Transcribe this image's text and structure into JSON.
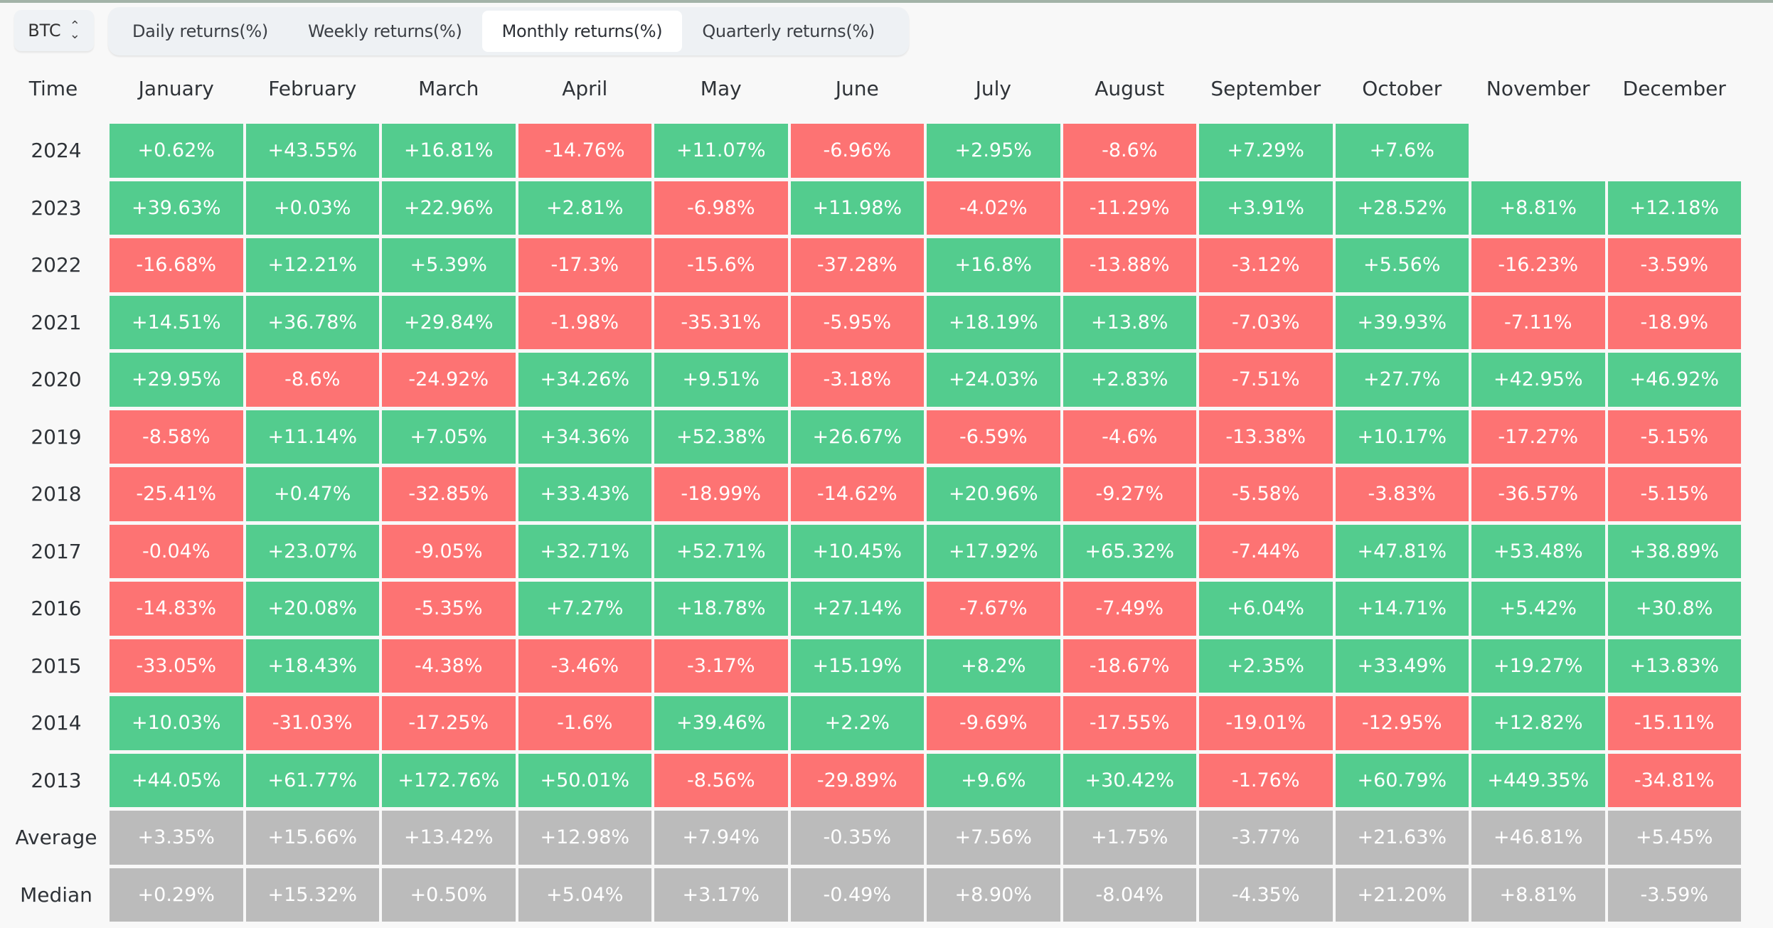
{
  "selector": {
    "value": "BTC",
    "icon": "up-down-chevron-icon"
  },
  "tabs": [
    {
      "label": "Daily returns(%)",
      "active": false
    },
    {
      "label": "Weekly returns(%)",
      "active": false
    },
    {
      "label": "Monthly returns(%)",
      "active": true
    },
    {
      "label": "Quarterly returns(%)",
      "active": false
    }
  ],
  "colors": {
    "positive": "#53cc8e",
    "negative": "#fd7373",
    "stat": "#bbbbbb"
  },
  "chart_data": {
    "type": "heatmap",
    "title": "BTC Monthly returns(%)",
    "row_header": "Time",
    "columns": [
      "January",
      "February",
      "March",
      "April",
      "May",
      "June",
      "July",
      "August",
      "September",
      "October",
      "November",
      "December"
    ],
    "rows": [
      {
        "label": "2024",
        "kind": "year",
        "values": [
          "+0.62%",
          "+43.55%",
          "+16.81%",
          "-14.76%",
          "+11.07%",
          "-6.96%",
          "+2.95%",
          "-8.6%",
          "+7.29%",
          "+7.6%",
          null,
          null
        ]
      },
      {
        "label": "2023",
        "kind": "year",
        "values": [
          "+39.63%",
          "+0.03%",
          "+22.96%",
          "+2.81%",
          "-6.98%",
          "+11.98%",
          "-4.02%",
          "-11.29%",
          "+3.91%",
          "+28.52%",
          "+8.81%",
          "+12.18%"
        ]
      },
      {
        "label": "2022",
        "kind": "year",
        "values": [
          "-16.68%",
          "+12.21%",
          "+5.39%",
          "-17.3%",
          "-15.6%",
          "-37.28%",
          "+16.8%",
          "-13.88%",
          "-3.12%",
          "+5.56%",
          "-16.23%",
          "-3.59%"
        ]
      },
      {
        "label": "2021",
        "kind": "year",
        "values": [
          "+14.51%",
          "+36.78%",
          "+29.84%",
          "-1.98%",
          "-35.31%",
          "-5.95%",
          "+18.19%",
          "+13.8%",
          "-7.03%",
          "+39.93%",
          "-7.11%",
          "-18.9%"
        ]
      },
      {
        "label": "2020",
        "kind": "year",
        "values": [
          "+29.95%",
          "-8.6%",
          "-24.92%",
          "+34.26%",
          "+9.51%",
          "-3.18%",
          "+24.03%",
          "+2.83%",
          "-7.51%",
          "+27.7%",
          "+42.95%",
          "+46.92%"
        ]
      },
      {
        "label": "2019",
        "kind": "year",
        "values": [
          "-8.58%",
          "+11.14%",
          "+7.05%",
          "+34.36%",
          "+52.38%",
          "+26.67%",
          "-6.59%",
          "-4.6%",
          "-13.38%",
          "+10.17%",
          "-17.27%",
          "-5.15%"
        ]
      },
      {
        "label": "2018",
        "kind": "year",
        "values": [
          "-25.41%",
          "+0.47%",
          "-32.85%",
          "+33.43%",
          "-18.99%",
          "-14.62%",
          "+20.96%",
          "-9.27%",
          "-5.58%",
          "-3.83%",
          "-36.57%",
          "-5.15%"
        ]
      },
      {
        "label": "2017",
        "kind": "year",
        "values": [
          "-0.04%",
          "+23.07%",
          "-9.05%",
          "+32.71%",
          "+52.71%",
          "+10.45%",
          "+17.92%",
          "+65.32%",
          "-7.44%",
          "+47.81%",
          "+53.48%",
          "+38.89%"
        ]
      },
      {
        "label": "2016",
        "kind": "year",
        "values": [
          "-14.83%",
          "+20.08%",
          "-5.35%",
          "+7.27%",
          "+18.78%",
          "+27.14%",
          "-7.67%",
          "-7.49%",
          "+6.04%",
          "+14.71%",
          "+5.42%",
          "+30.8%"
        ]
      },
      {
        "label": "2015",
        "kind": "year",
        "values": [
          "-33.05%",
          "+18.43%",
          "-4.38%",
          "-3.46%",
          "-3.17%",
          "+15.19%",
          "+8.2%",
          "-18.67%",
          "+2.35%",
          "+33.49%",
          "+19.27%",
          "+13.83%"
        ]
      },
      {
        "label": "2014",
        "kind": "year",
        "values": [
          "+10.03%",
          "-31.03%",
          "-17.25%",
          "-1.6%",
          "+39.46%",
          "+2.2%",
          "-9.69%",
          "-17.55%",
          "-19.01%",
          "-12.95%",
          "+12.82%",
          "-15.11%"
        ]
      },
      {
        "label": "2013",
        "kind": "year",
        "values": [
          "+44.05%",
          "+61.77%",
          "+172.76%",
          "+50.01%",
          "-8.56%",
          "-29.89%",
          "+9.6%",
          "+30.42%",
          "-1.76%",
          "+60.79%",
          "+449.35%",
          "-34.81%"
        ]
      },
      {
        "label": "Average",
        "kind": "stat",
        "values": [
          "+3.35%",
          "+15.66%",
          "+13.42%",
          "+12.98%",
          "+7.94%",
          "-0.35%",
          "+7.56%",
          "+1.75%",
          "-3.77%",
          "+21.63%",
          "+46.81%",
          "+5.45%"
        ]
      },
      {
        "label": "Median",
        "kind": "stat",
        "values": [
          "+0.29%",
          "+15.32%",
          "+0.50%",
          "+5.04%",
          "+3.17%",
          "-0.49%",
          "+8.90%",
          "-8.04%",
          "-4.35%",
          "+21.20%",
          "+8.81%",
          "-3.59%"
        ]
      }
    ]
  }
}
